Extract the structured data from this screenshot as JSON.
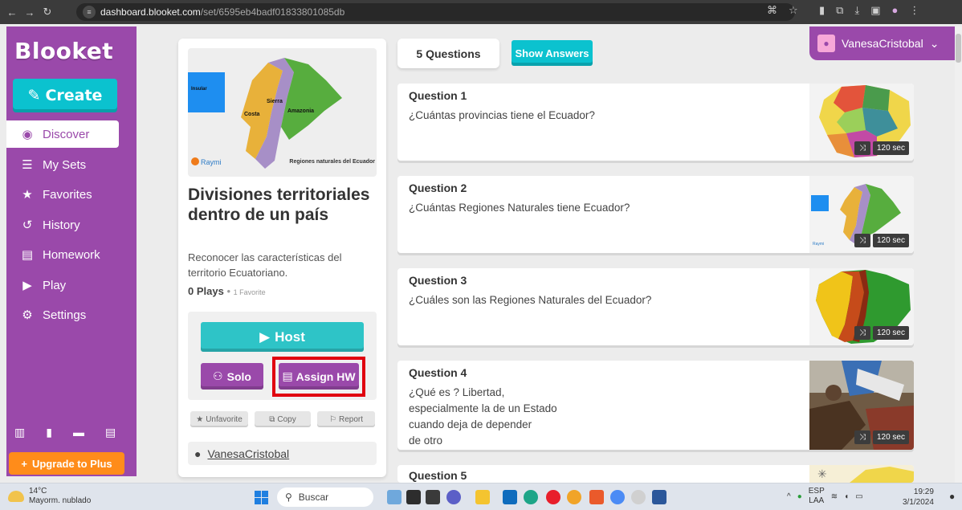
{
  "browser": {
    "url_host": "dashboard.blooket.com",
    "url_path": "/set/6595eb4badf01833801085db"
  },
  "sidebar": {
    "logo": "Blooket",
    "create_label": "Create",
    "items": [
      {
        "label": "Discover",
        "icon": "compass-icon",
        "active": true
      },
      {
        "label": "My Sets",
        "icon": "list-icon"
      },
      {
        "label": "Favorites",
        "icon": "star-icon"
      },
      {
        "label": "History",
        "icon": "history-icon"
      },
      {
        "label": "Homework",
        "icon": "file-icon"
      },
      {
        "label": "Play",
        "icon": "play-icon"
      },
      {
        "label": "Settings",
        "icon": "gear-icon"
      }
    ],
    "upgrade_label": "Upgrade to Plus"
  },
  "set": {
    "image": {
      "insular": "Insular",
      "costa": "Costa",
      "sierra": "Sierra",
      "amazonia": "Amazonia",
      "caption": "Regiones naturales del Ecuador",
      "brand": "Raymi"
    },
    "title": "Divisiones territoriales dentro de un país",
    "description": "Reconocer las características del territorio Ecuatoriano.",
    "plays": "0 Plays",
    "favorites": "1 Favorite",
    "host_label": "Host",
    "solo_label": "Solo",
    "assign_label": "Assign HW",
    "unfavorite_label": "Unfavorite",
    "copy_label": "Copy",
    "report_label": "Report",
    "author": "VanesaCristobal"
  },
  "questions_header": {
    "count_label": "5 Questions",
    "show_answers_label": "Show Answers"
  },
  "questions": [
    {
      "number": "Question 1",
      "text": "¿Cuántas provincias tiene el Ecuador?",
      "time": "120 sec"
    },
    {
      "number": "Question 2",
      "text": "¿Cuántas Regiones Naturales tiene Ecuador?",
      "time": "120 sec"
    },
    {
      "number": "Question 3",
      "text": "¿Cuáles son las Regiones Naturales del Ecuador?",
      "time": "120 sec"
    },
    {
      "number": "Question 4",
      "text": "¿Qué es ? Libertad,",
      "text_lines": [
        "¿Qué es ? Libertad,",
        "especialmente la de un Estado",
        "cuando deja de depender",
        "de otro"
      ],
      "time": "120 sec"
    },
    {
      "number": "Question 5"
    }
  ],
  "user": {
    "name": "VanesaCristobal"
  },
  "taskbar": {
    "temp": "14°C",
    "weather": "Mayorm. nublado",
    "search_placeholder": "Buscar",
    "lang_1": "ESP",
    "lang_2": "LAA",
    "time": "19:29",
    "date": "3/1/2024"
  },
  "colors": {
    "brand_purple": "#9a49aa",
    "accent_cyan": "#0bc2cf",
    "upgrade_orange": "#ff8c1a",
    "highlight_red": "#e0000f"
  }
}
